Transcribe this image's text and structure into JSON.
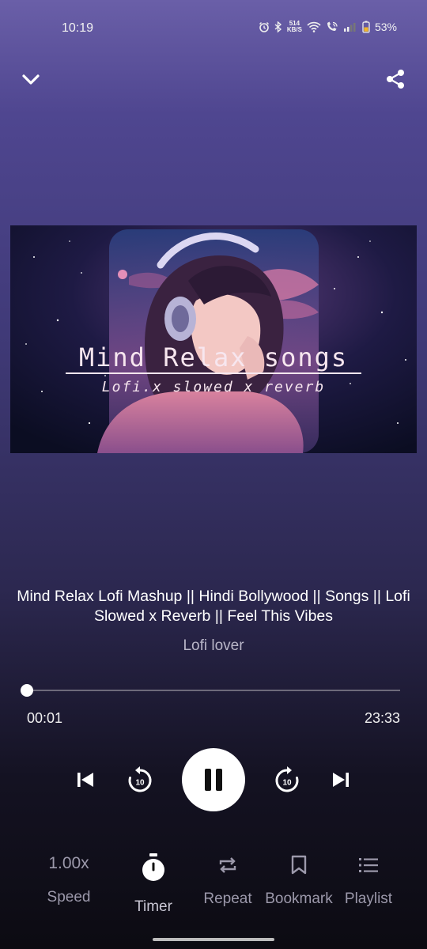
{
  "status_bar": {
    "time": "10:19",
    "net_speed_top": "514",
    "net_speed_unit": "KB/S",
    "battery": "53%"
  },
  "header": {
    "collapse_icon": "chevron-down-icon",
    "share_icon": "share-icon"
  },
  "artwork": {
    "text_main": "Mind Relax songs",
    "text_sub": "Lofi.x slowed x reverb"
  },
  "track": {
    "title": "Mind Relax Lofi Mashup || Hindi Bollywood || Songs || Lofi Slowed x Reverb || Feel This Vibes",
    "artist": "Lofi lover"
  },
  "progress": {
    "current": "00:01",
    "total": "23:33",
    "fraction": 0.001
  },
  "controls": {
    "rewind_seconds": "10",
    "forward_seconds": "10"
  },
  "options": {
    "speed_value": "1.00x",
    "speed_label": "Speed",
    "timer_label": "Timer",
    "repeat_label": "Repeat",
    "bookmark_label": "Bookmark",
    "playlist_label": "Playlist"
  },
  "colors": {
    "accent": "#ffffff",
    "muted": "#9c99ab"
  }
}
